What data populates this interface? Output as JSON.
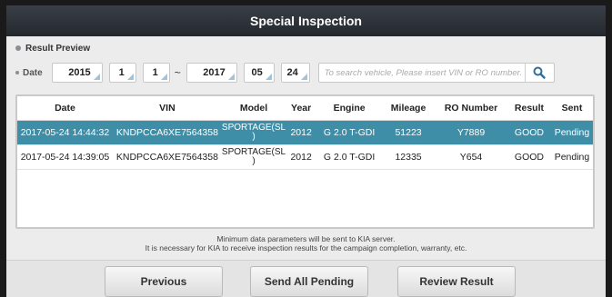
{
  "header": {
    "title": "Special Inspection"
  },
  "section": {
    "label": "Result Preview"
  },
  "filter": {
    "date_label": "Date",
    "from_year": "2015",
    "from_month": "1",
    "from_day": "1",
    "separator": "~",
    "to_year": "2017",
    "to_month": "05",
    "to_day": "24",
    "search_placeholder": "To search vehicle, Please insert VIN or RO number."
  },
  "table": {
    "columns": [
      "Date",
      "VIN",
      "Model",
      "Year",
      "Engine",
      "Mileage",
      "RO Number",
      "Result",
      "Sent"
    ],
    "rows": [
      [
        "2017-05-24 14:44:32",
        "KNDPCCA6XE7564358",
        "SPORTAGE(SL\n)",
        "2012",
        "G 2.0 T-GDI",
        "51223",
        "Y7889",
        "GOOD",
        "Pending"
      ],
      [
        "2017-05-24 14:39:05",
        "KNDPCCA6XE7564358",
        "SPORTAGE(SL\n)",
        "2012",
        "G 2.0 T-GDI",
        "12335",
        "Y654",
        "GOOD",
        "Pending"
      ]
    ]
  },
  "notice": {
    "line1": "Minimum data parameters will be sent to KIA server.",
    "line2": "It is necessary for KIA to receive inspection results for the campaign completion, warranty, etc."
  },
  "buttons": {
    "previous": "Previous",
    "send_all": "Send All Pending",
    "review": "Review Result"
  },
  "colors": {
    "selected_row": "#3e8ea8",
    "titlebar": "#2e333a",
    "accent_arrow": "#9fc4d8",
    "search_icon": "#2d6f9a"
  },
  "icons": {
    "search": "magnifier-icon",
    "section_bullet": "bullet-icon"
  }
}
